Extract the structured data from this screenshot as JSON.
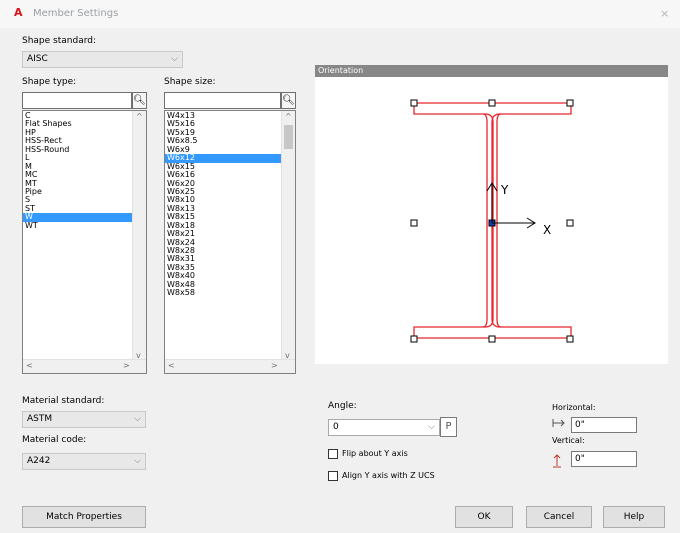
{
  "window": {
    "title": "Member Settings",
    "close_glyph": "×",
    "app_glyph": "A"
  },
  "shape_standard": {
    "label": "Shape standard:",
    "value": "AISC"
  },
  "shape_type": {
    "label": "Shape type:",
    "search_value": "",
    "items": [
      "C",
      "Flat Shapes",
      "HP",
      "HSS-Rect",
      "HSS-Round",
      "L",
      "M",
      "MC",
      "MT",
      "Pipe",
      "S",
      "ST",
      "W",
      "WT"
    ],
    "selected": "W"
  },
  "shape_size": {
    "label": "Shape size:",
    "search_value": "",
    "items": [
      "W4x13",
      "W5x16",
      "W5x19",
      "W6x8.5",
      "W6x9",
      "W6x12",
      "W6x15",
      "W6x16",
      "W6x20",
      "W6x25",
      "W8x10",
      "W8x13",
      "W8x15",
      "W8x18",
      "W8x21",
      "W8x24",
      "W8x28",
      "W8x31",
      "W8x35",
      "W8x40",
      "W8x48",
      "W8x58"
    ],
    "selected": "W6x12"
  },
  "orientation": {
    "label": "Orientation",
    "y_axis_label": "Y",
    "x_axis_label": "X"
  },
  "material_standard": {
    "label": "Material standard:",
    "value": "ASTM"
  },
  "material_code": {
    "label": "Material code:",
    "value": "A242"
  },
  "angle": {
    "label": "Angle:",
    "value": "0"
  },
  "flip_y": {
    "label": "Flip about Y axis",
    "checked": false
  },
  "align_y": {
    "label": "Align Y axis with Z UCS",
    "checked": false
  },
  "horizontal": {
    "label": "Horizontal:",
    "value": "0\""
  },
  "vertical": {
    "label": "Vertical:",
    "value": "0\""
  },
  "buttons": {
    "match": "Match Properties",
    "ok": "OK",
    "cancel": "Cancel",
    "help": "Help"
  },
  "colors": {
    "selection": "#3399ff",
    "profile": "#e8262d",
    "header": "#878787"
  }
}
